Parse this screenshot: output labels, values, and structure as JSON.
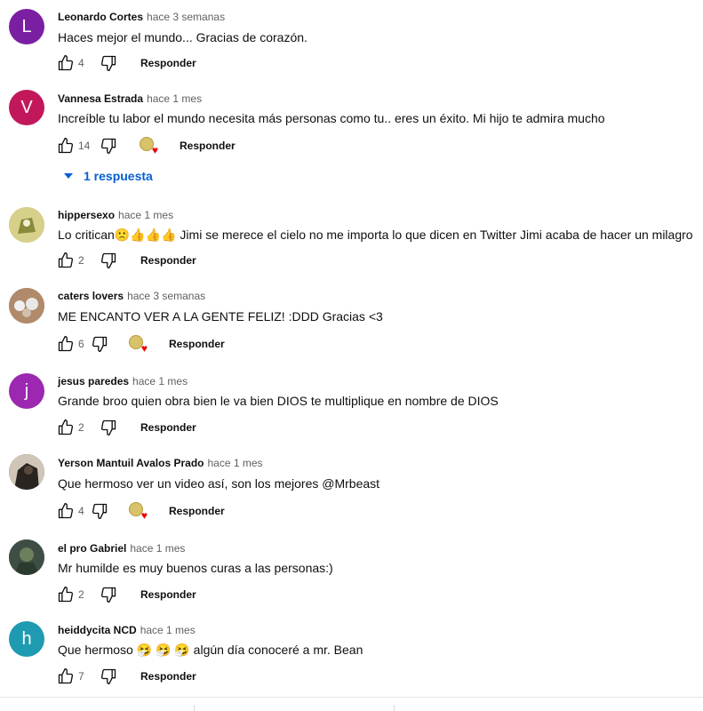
{
  "reply_label": "Responder",
  "comments": [
    {
      "initial": "L",
      "avatar_color": "#7b1fa2",
      "author": "Leonardo Cortes",
      "time": "hace 3 semanas",
      "text": "Haces mejor el mundo... Gracias de corazón.",
      "likes": "4",
      "hearted": false
    },
    {
      "initial": "V",
      "avatar_color": "#c2185b",
      "author": "Vannesa Estrada",
      "time": "hace 1 mes",
      "text": "Increíble tu labor el mundo necesita  más personas como tu.. eres un éxito. Mi hijo te admira mucho",
      "likes": "14",
      "hearted": true,
      "replies_label": "1 respuesta"
    },
    {
      "initial": "",
      "avatar_color": "#c9c97a",
      "author": "hippersexo",
      "time": "hace 1 mes",
      "text_before": "Lo critican",
      "emojis": "🙁👍👍👍",
      "text_after": " Jimi se merece el cielo no me importa lo que dicen en Twitter Jimi acaba de hacer un milagro",
      "likes": "2",
      "hearted": false
    },
    {
      "initial": "",
      "avatar_color": "#a07a5a",
      "author": "caters lovers",
      "time": "hace 3 semanas",
      "text": "ME ENCANTO VER A LA GENTE FELIZ! :DDD Gracias <3",
      "likes": "6",
      "hearted": true
    },
    {
      "initial": "j",
      "avatar_color": "#9c27b0",
      "author": "jesus paredes",
      "time": "hace 1 mes",
      "text": "Grande broo quien obra bien le va bien DIOS te multiplique en nombre de DIOS",
      "likes": "2",
      "hearted": false
    },
    {
      "initial": "",
      "avatar_color": "#3a332e",
      "author": "Yerson Mantuil Avalos Prado",
      "time": "hace 1 mes",
      "text": "Que hermoso ver un video así, son los mejores @Mrbeast",
      "likes": "4",
      "hearted": true
    },
    {
      "initial": "",
      "avatar_color": "#4a5a4a",
      "author": "el pro Gabriel",
      "time": "hace 1 mes",
      "text": "Mr humilde es muy buenos curas a las personas:)",
      "likes": "2",
      "hearted": false
    },
    {
      "initial": "h",
      "avatar_color": "#1e9bb0",
      "author": "heiddycita NCD",
      "time": "hace 1 mes",
      "text_before": "Que hermoso ",
      "emojis": "🤧 🤧 🤧",
      "text_after": " algún día conoceré a mr. Bean",
      "likes": "7",
      "hearted": false
    }
  ]
}
